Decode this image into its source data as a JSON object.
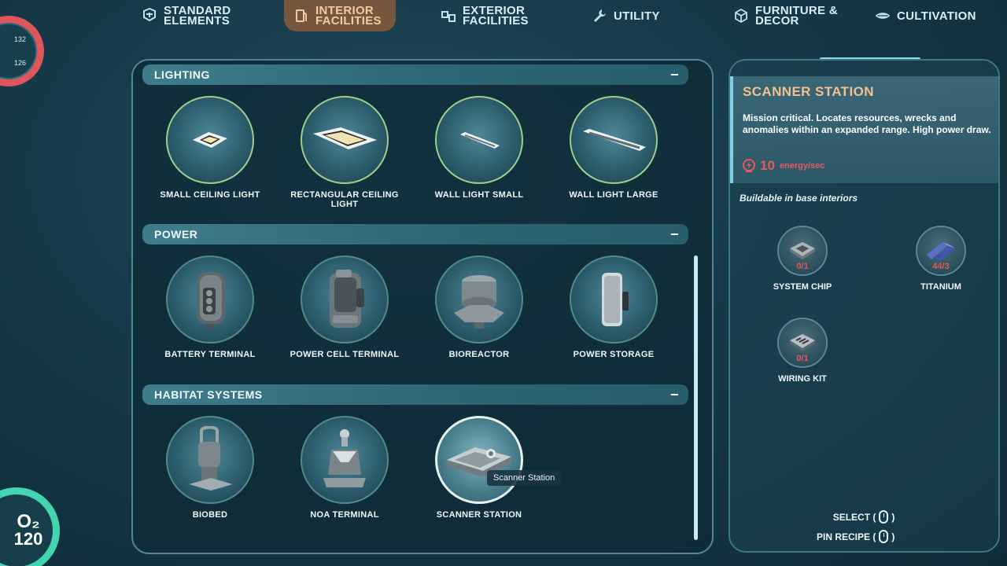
{
  "tabs": [
    {
      "label": "STANDARD\nELEMENTS",
      "icon": "standard-elements-icon",
      "active": false
    },
    {
      "label": "INTERIOR\nFACILITIES",
      "icon": "interior-facilities-icon",
      "active": true
    },
    {
      "label": "EXTERIOR\nFACILITIES",
      "icon": "exterior-facilities-icon",
      "active": false
    },
    {
      "label": "UTILITY",
      "icon": "wrench-icon",
      "active": false
    },
    {
      "label": "FURNITURE &\nDECOR",
      "icon": "furniture-cube-icon",
      "active": false
    },
    {
      "label": "CULTIVATION",
      "icon": "cultivation-icon",
      "active": false
    }
  ],
  "hud": {
    "top_gauge": {
      "value_a": "132",
      "value_b": "126",
      "color": "#e0555a"
    },
    "oxygen": {
      "symbol": "O₂",
      "value": "120",
      "color": "#42d6b0"
    }
  },
  "sections": [
    {
      "title": "LIGHTING",
      "collapse_symbol": "−",
      "items": [
        {
          "label": "SMALL CEILING LIGHT",
          "icon": "small-ceiling-light-icon"
        },
        {
          "label": "RECTANGULAR CEILING\nLIGHT",
          "icon": "rectangular-ceiling-light-icon"
        },
        {
          "label": "WALL LIGHT SMALL",
          "icon": "wall-light-small-icon"
        },
        {
          "label": "WALL LIGHT LARGE",
          "icon": "wall-light-large-icon"
        }
      ]
    },
    {
      "title": "POWER",
      "collapse_symbol": "−",
      "items": [
        {
          "label": "BATTERY TERMINAL",
          "icon": "battery-terminal-icon"
        },
        {
          "label": "POWER CELL TERMINAL",
          "icon": "power-cell-terminal-icon"
        },
        {
          "label": "BIOREACTOR",
          "icon": "bioreactor-icon"
        },
        {
          "label": "POWER STORAGE",
          "icon": "power-storage-icon"
        }
      ]
    },
    {
      "title": "HABITAT SYSTEMS",
      "collapse_symbol": "−",
      "items": [
        {
          "label": "BIOBED",
          "icon": "biobed-icon"
        },
        {
          "label": "NOA TERMINAL",
          "icon": "noa-terminal-icon"
        },
        {
          "label": "SCANNER STATION",
          "icon": "scanner-station-icon",
          "selected": true
        }
      ]
    }
  ],
  "tooltip": "Scanner Station",
  "detail": {
    "title": "SCANNER STATION",
    "description": "Mission critical. Locates resources, wrecks and anomalies within an expanded range. High power draw.",
    "energy_value": "10",
    "energy_unit": "energy/sec",
    "energy_color": "#e35b5e",
    "buildable": "Buildable in base interiors",
    "ingredients": [
      {
        "name": "SYSTEM CHIP",
        "count": "0/1",
        "icon": "system-chip-icon",
        "have": false
      },
      {
        "name": "TITANIUM",
        "count": "44/3",
        "icon": "titanium-icon",
        "have": true
      },
      {
        "name": "WIRING KIT",
        "count": "0/1",
        "icon": "wiring-kit-icon",
        "have": false
      }
    ],
    "controls": [
      {
        "label": "SELECT (",
        "suffix": ")",
        "icon": "mouse-left-icon"
      },
      {
        "label": "PIN RECIPE (",
        "suffix": ")",
        "icon": "mouse-right-icon"
      }
    ]
  },
  "colors": {
    "accent": "#f4c08f",
    "panel_border": "#4f8897",
    "need": "#e2575c",
    "have": "#94e06b"
  }
}
